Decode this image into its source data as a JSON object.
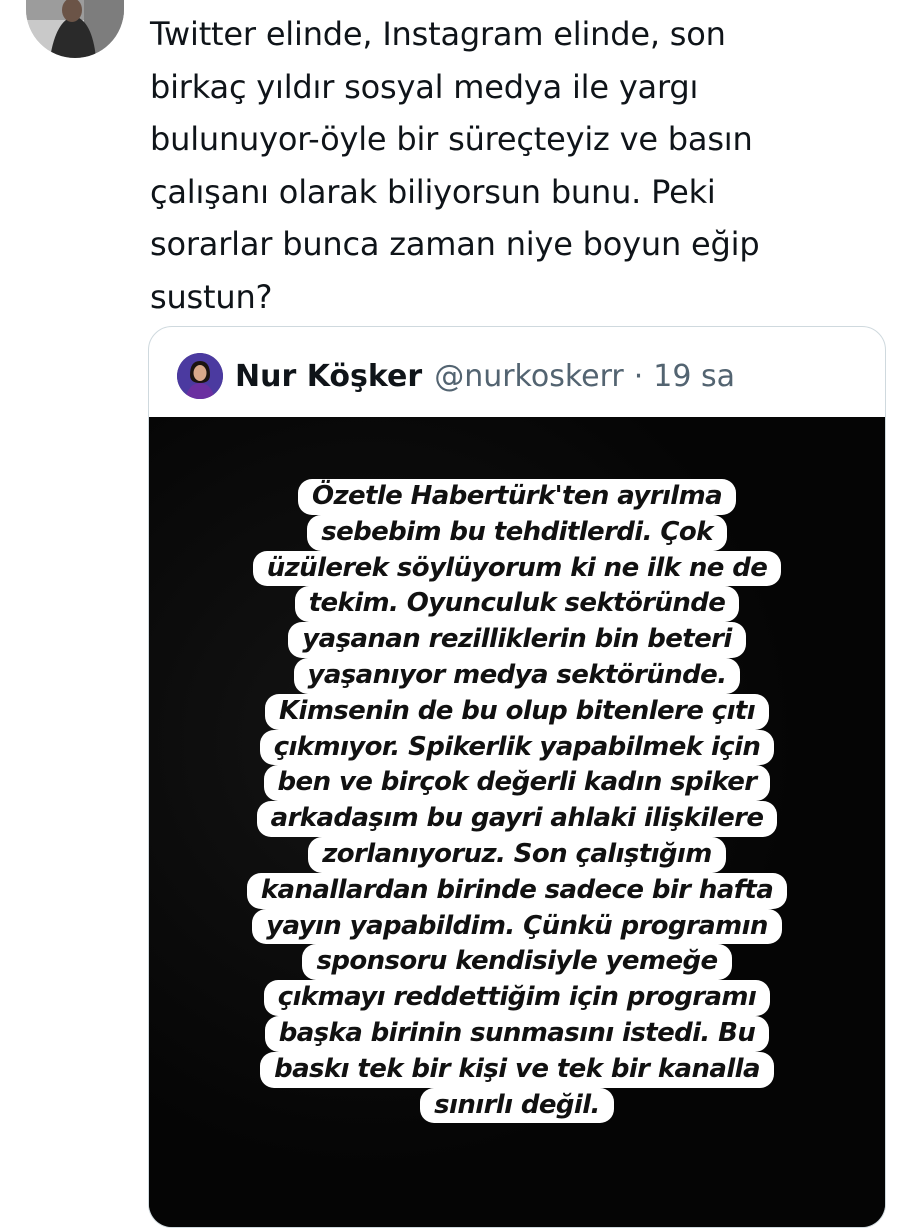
{
  "tweet": {
    "lines": [
      "Twitter elinde, Instagram elinde, son",
      "birkaç yıldır sosyal medya ile yargı",
      "bulunuyor-öyle bir süreçteyiz ve basın",
      "çalışanı olarak biliyorsun bunu. Peki",
      "sorarlar bunca zaman niye boyun eğip",
      "sustun?"
    ]
  },
  "quote": {
    "name": "Nur Köşker",
    "handle": "@nurkoskerr",
    "separator": "·",
    "time": "19 sa",
    "story_lines": [
      "Özetle Habertürk'ten ayrılma",
      "sebebim bu tehditlerdi. Çok",
      "üzülerek söylüyorum ki ne ilk ne de",
      "tekim. Oyunculuk sektöründe",
      "yaşanan rezilliklerin bin beteri",
      "yaşanıyor medya sektöründe.",
      "Kimsenin de bu olup bitenlere çıtı",
      "çıkmıyor. Spikerlik yapabilmek için",
      "ben ve birçok değerli kadın spiker",
      "arkadaşım bu gayri ahlaki ilişkilere",
      "zorlanıyoruz. Son çalıştığım",
      "kanallardan birinde sadece bir hafta",
      "yayın yapabildim. Çünkü programın",
      "sponsoru kendisiyle yemeğe",
      "çıkmayı reddettiğim için programı",
      "başka birinin sunmasını istedi. Bu",
      "baskı tek bir kişi ve tek bir kanalla",
      "sınırlı değil."
    ]
  },
  "colors": {
    "text_primary": "#0f1419",
    "text_secondary": "#536471",
    "card_border": "#cfd9de",
    "story_background": "#060606",
    "story_text_highlight": "#ffffff"
  }
}
